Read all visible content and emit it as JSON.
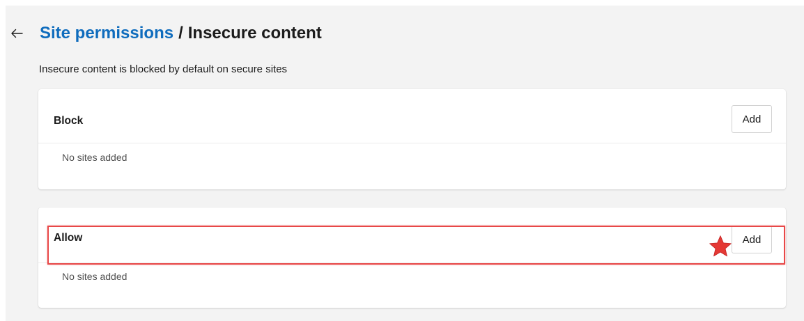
{
  "header": {
    "parent_link": "Site permissions",
    "separator": "/",
    "current": "Insecure content"
  },
  "description": "Insecure content is blocked by default on secure sites",
  "sections": [
    {
      "title": "Block",
      "add_label": "Add",
      "empty_text": "No sites added"
    },
    {
      "title": "Allow",
      "add_label": "Add",
      "empty_text": "No sites added"
    }
  ],
  "colors": {
    "link": "#0f6cbd",
    "highlight": "#e84848",
    "star": "#e53935",
    "page_background": "#f3f3f3"
  },
  "icons": {
    "back": "back-arrow-icon",
    "marker": "star-icon"
  }
}
